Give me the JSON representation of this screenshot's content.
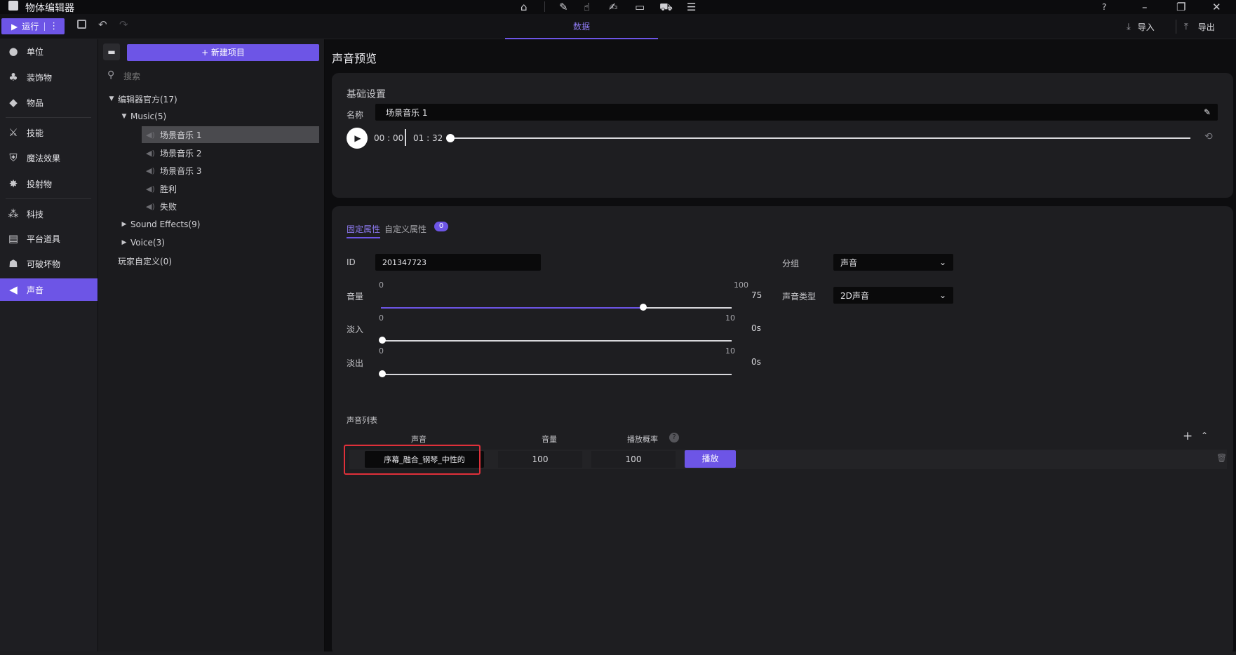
{
  "app": {
    "title": "物体编辑器"
  },
  "toolbar": {
    "run_label": "运行",
    "data_tab": "数据",
    "import_label": "导入",
    "export_label": "导出"
  },
  "leftnav": {
    "items": [
      {
        "label": "单位",
        "icon": "person-icon"
      },
      {
        "label": "装饰物",
        "icon": "tree-icon"
      },
      {
        "label": "物品",
        "icon": "cube-icon"
      },
      {
        "label": "技能",
        "icon": "sword-icon"
      },
      {
        "label": "魔法效果",
        "icon": "shield-magic-icon"
      },
      {
        "label": "投射物",
        "icon": "projectile-icon"
      },
      {
        "label": "科技",
        "icon": "tech-icon"
      },
      {
        "label": "平台道具",
        "icon": "platform-icon"
      },
      {
        "label": "可破坏物",
        "icon": "destructible-icon"
      },
      {
        "label": "声音",
        "icon": "speaker-icon"
      }
    ]
  },
  "tree": {
    "new_item_label": "+ 新建项目",
    "search_placeholder": "搜索",
    "root": "编辑器官方(17)",
    "music_folder": "Music(5)",
    "music_items": [
      "场景音乐 1",
      "场景音乐 2",
      "场景音乐 3",
      "胜利",
      "失败"
    ],
    "sound_effects": "Sound Effects(9)",
    "voice": "Voice(3)",
    "custom": "玩家自定义(0)"
  },
  "main": {
    "page_title": "声音预览",
    "basic": {
      "section_title": "基础设置",
      "name_label": "名称",
      "name_value": "场景音乐 1",
      "current_time": "00 : 00",
      "total_time": "01 : 32",
      "playback_progress": 0
    },
    "tabs": {
      "fixed": "固定属性",
      "custom": "自定义属性",
      "custom_count": "0"
    },
    "fields": {
      "id_label": "ID",
      "id_value": "201347723",
      "group_label": "分组",
      "group_value": "声音",
      "volume_label": "音量",
      "volume_min": "0",
      "volume_max": "100",
      "volume_value": "75",
      "sound_type_label": "声音类型",
      "sound_type_value": "2D声音",
      "fade_in_label": "淡入",
      "fade_in_min": "0",
      "fade_in_max": "10",
      "fade_in_value": "0s",
      "fade_out_label": "淡出",
      "fade_out_min": "0",
      "fade_out_max": "10",
      "fade_out_value": "0s"
    },
    "sound_list": {
      "title": "声音列表",
      "col_sound": "声音",
      "col_volume": "音量",
      "col_probability": "播放概率",
      "row": {
        "sound": "序幕_融合_钢琴_中性的",
        "volume": "100",
        "probability": "100",
        "play_label": "播放"
      }
    }
  },
  "colors": {
    "accent": "#6d55e6",
    "highlight_box": "#e0303a"
  }
}
